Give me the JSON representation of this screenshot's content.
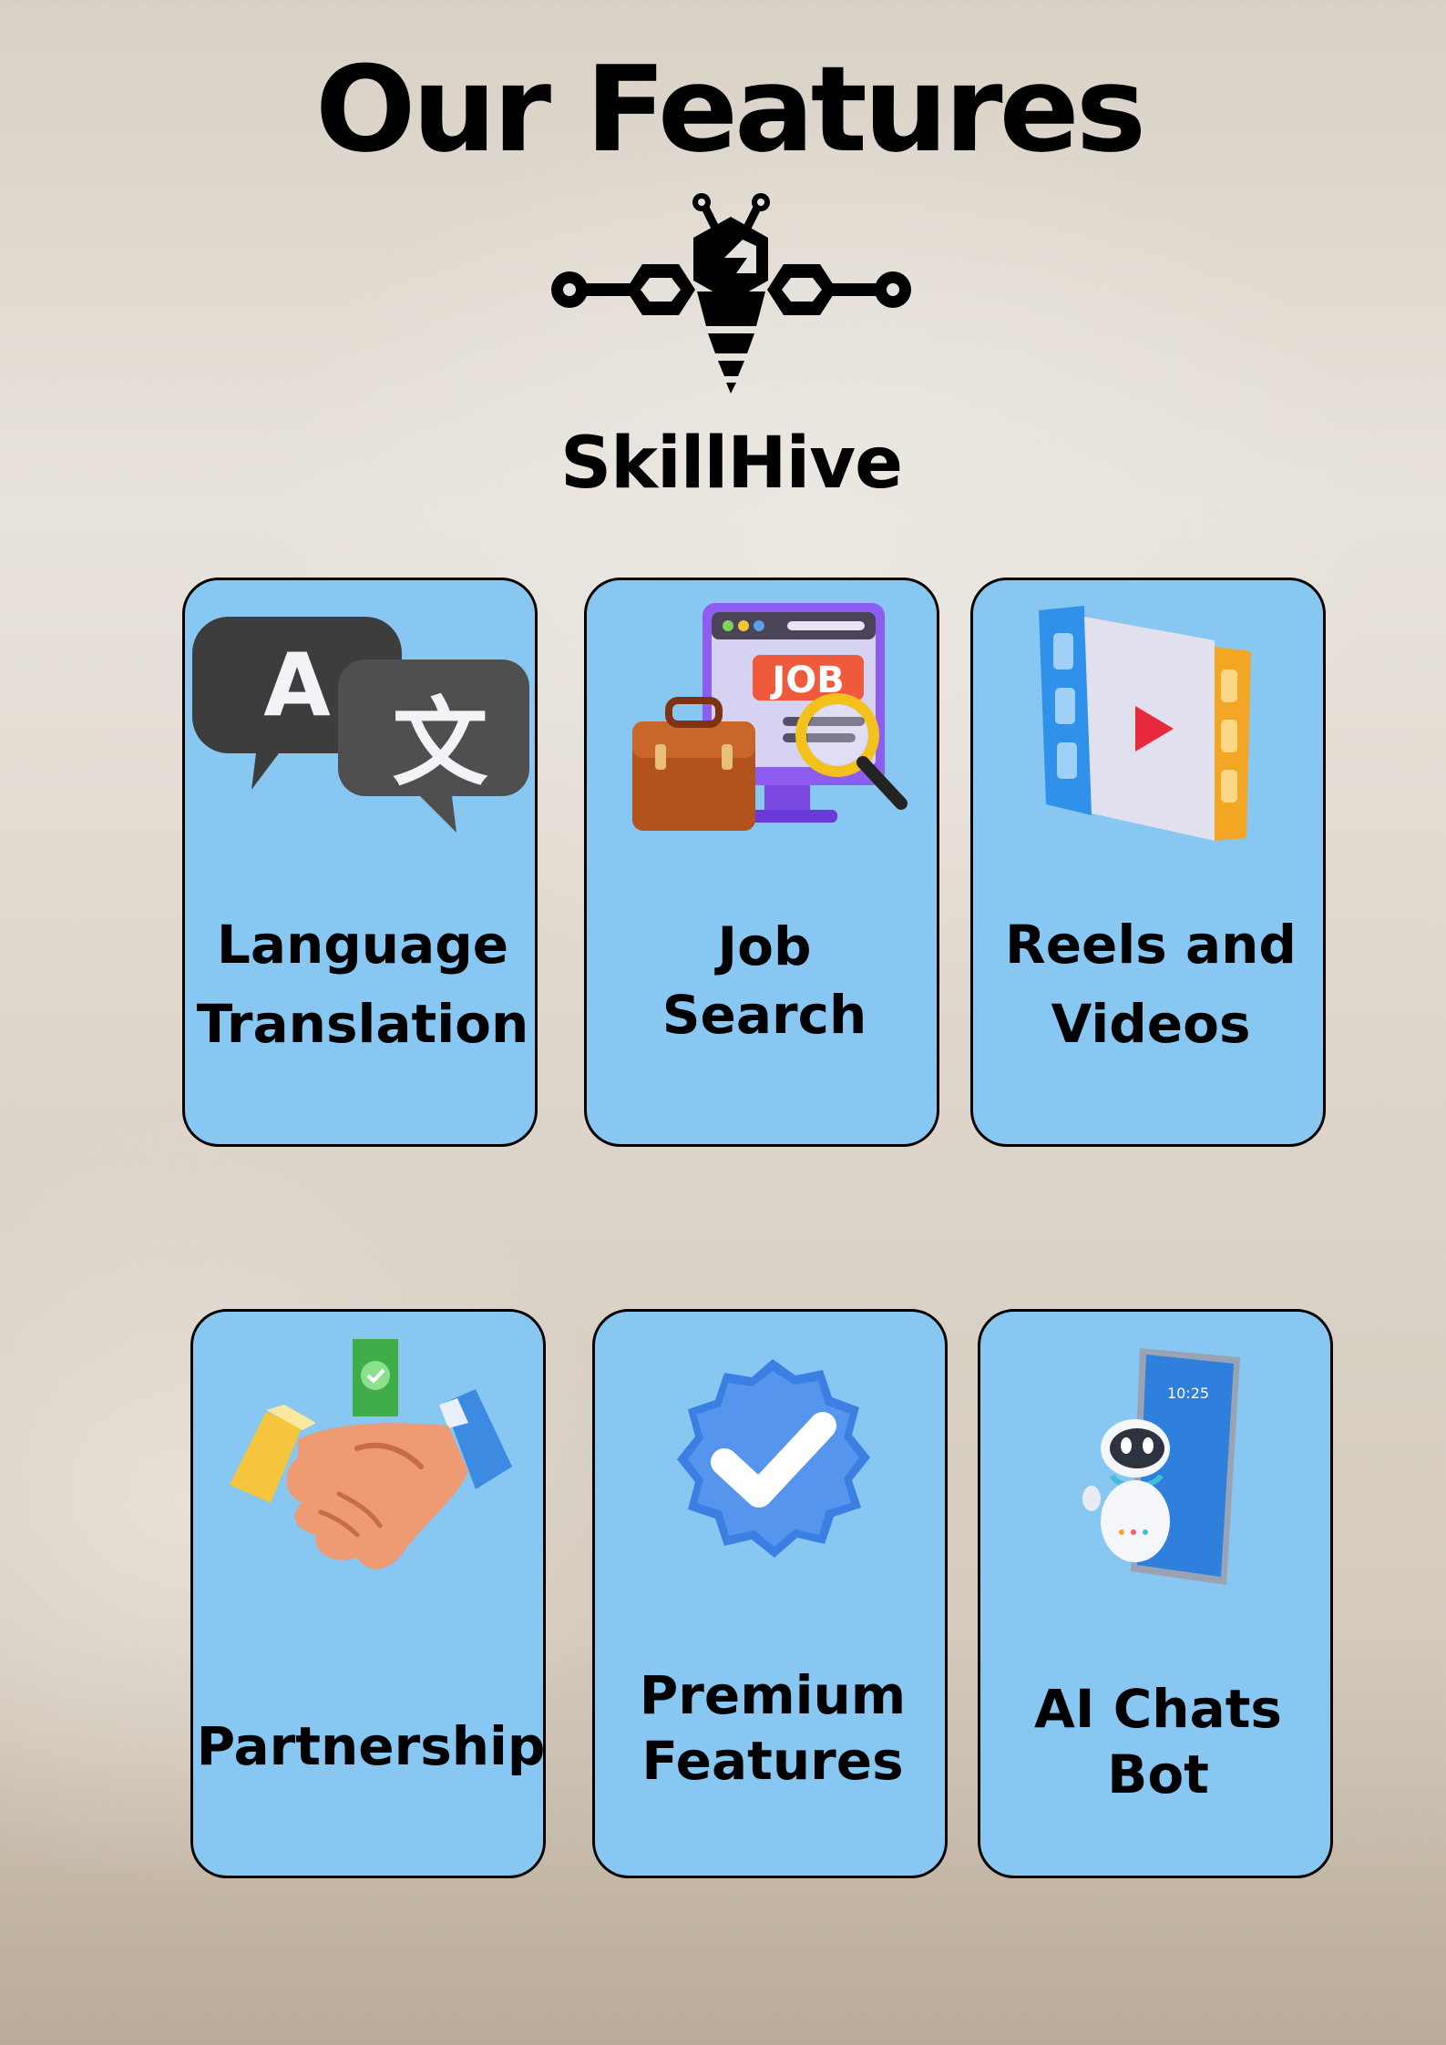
{
  "page": {
    "title": "Our Features",
    "brand": "SkillHive"
  },
  "colors": {
    "card_fill": "#87c7f1",
    "card_border": "#000000",
    "text": "#000000"
  },
  "features": [
    {
      "line1": "Language",
      "line2": "Translation",
      "icon": "translate-chat-bubbles-icon"
    },
    {
      "line1": "Job",
      "line2": "Search",
      "icon": "job-search-monitor-icon"
    },
    {
      "line1": "Reels and",
      "line2": "Videos",
      "icon": "video-reel-icon"
    },
    {
      "line1": "Partnership",
      "line2": "",
      "icon": "handshake-icon"
    },
    {
      "line1": "Premium",
      "line2": "Features",
      "icon": "verified-badge-icon"
    },
    {
      "line1": "AI Chats",
      "line2": "Bot",
      "icon": "robot-phone-icon"
    }
  ]
}
